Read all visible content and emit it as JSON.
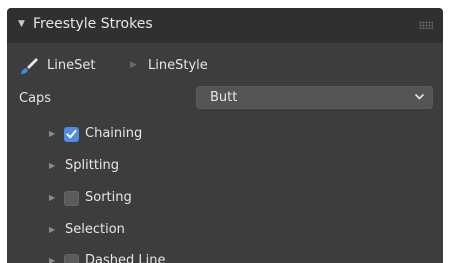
{
  "panel": {
    "title": "Freestyle Strokes",
    "expanded_icon": "triangle-down-icon",
    "drag_icon": "drag-handle-icon"
  },
  "breadcrumb": {
    "icon": "brush-icon",
    "items": [
      "LineSet",
      "LineStyle"
    ],
    "separator_icon": "chevron-right-icon"
  },
  "caps": {
    "label": "Caps",
    "value": "Butt"
  },
  "subpanels": [
    {
      "label": "Chaining",
      "has_checkbox": true,
      "checked": true
    },
    {
      "label": "Splitting",
      "has_checkbox": false
    },
    {
      "label": "Sorting",
      "has_checkbox": true,
      "checked": false
    },
    {
      "label": "Selection",
      "has_checkbox": false
    },
    {
      "label": "Dashed Line",
      "has_checkbox": true,
      "checked": false
    }
  ],
  "colors": {
    "panel_bg": "#3d3d3d",
    "header_bg": "#303030",
    "select_bg": "#545454",
    "accent": "#4f8be0",
    "text": "#e6e6e6"
  }
}
